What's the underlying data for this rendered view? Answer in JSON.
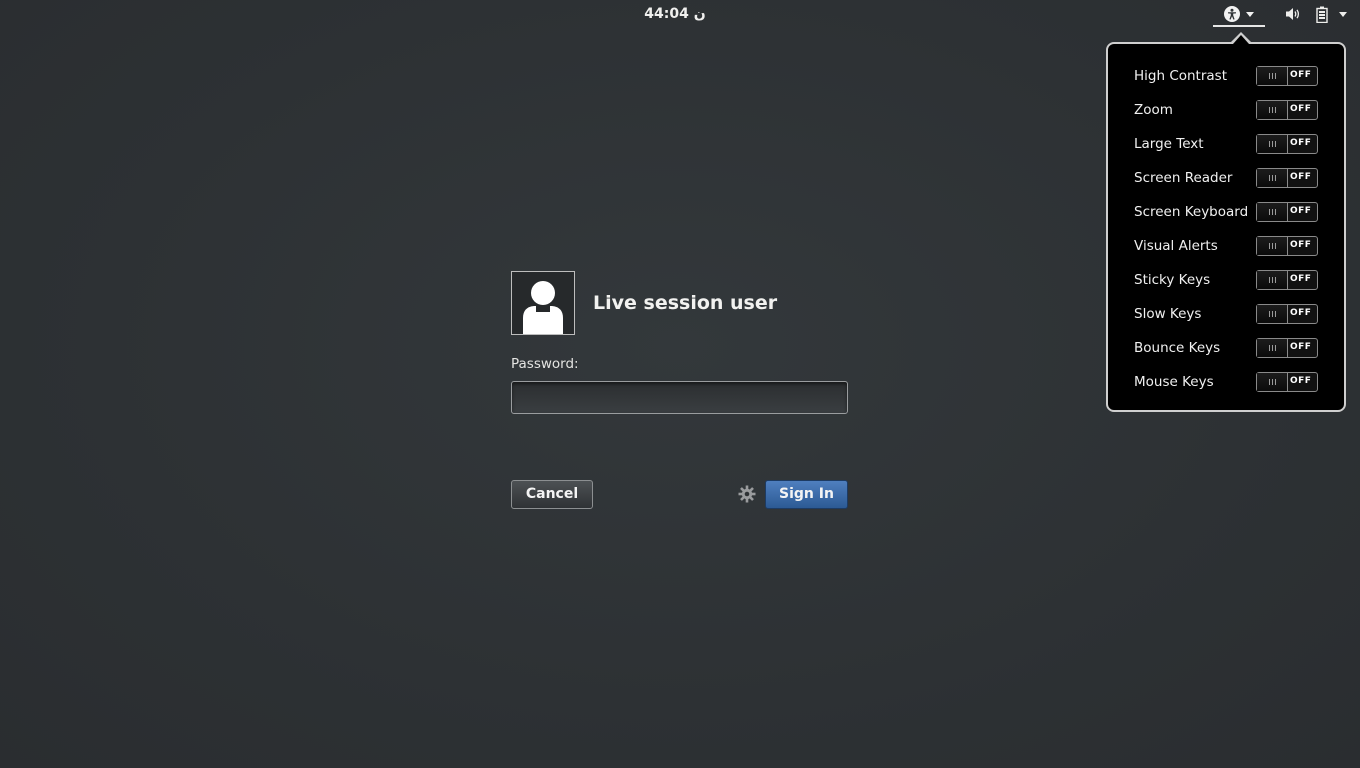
{
  "topbar": {
    "clock": "44:04 ن"
  },
  "icons": {
    "accessibility": "accessibility-icon",
    "volume": "speaker-icon",
    "battery": "battery-icon",
    "gear": "gear-icon"
  },
  "accessibility_menu": {
    "items": [
      {
        "label": "High Contrast",
        "state": "OFF"
      },
      {
        "label": "Zoom",
        "state": "OFF"
      },
      {
        "label": "Large Text",
        "state": "OFF"
      },
      {
        "label": "Screen Reader",
        "state": "OFF"
      },
      {
        "label": "Screen Keyboard",
        "state": "OFF"
      },
      {
        "label": "Visual Alerts",
        "state": "OFF"
      },
      {
        "label": "Sticky Keys",
        "state": "OFF"
      },
      {
        "label": "Slow Keys",
        "state": "OFF"
      },
      {
        "label": "Bounce Keys",
        "state": "OFF"
      },
      {
        "label": "Mouse Keys",
        "state": "OFF"
      }
    ]
  },
  "login": {
    "username": "Live session user",
    "password_label": "Password:",
    "password_value": "",
    "cancel_label": "Cancel",
    "signin_label": "Sign In"
  },
  "colors": {
    "background": "#2e3235",
    "signin_button": "#3a6aa8",
    "popup_background": "#000000"
  }
}
